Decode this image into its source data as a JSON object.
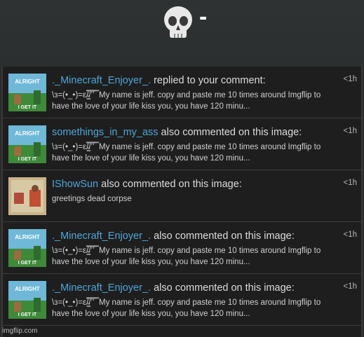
{
  "header": {
    "emoji": "💀",
    "dash": "-"
  },
  "notifications": [
    {
      "username": "._Minecraft_Enjoyer_.",
      "action": " replied to your comment:",
      "text": "\\з=(•_•)=ε/̵͇̿̿/’̿’̿ ̿ My name is jeff. copy and paste me 10 times around Imgflip to have the love of your life kiss you, you have 120 minu...",
      "time": "<1h",
      "thumb": "alright"
    },
    {
      "username": "somethings_in_my_ass",
      "action": " also commented on this image:",
      "text": "\\з=(•_•)=ε/̵͇̿̿/’̿’̿ ̿ My name is jeff. copy and paste me 10 times around Imgflip to have the love of your life kiss you, you have 120 minu...",
      "time": "<1h",
      "thumb": "alright"
    },
    {
      "username": "IShowSun",
      "action": " also commented on this image:",
      "text": "greetings dead corpse",
      "time": "<1h",
      "thumb": "painting"
    },
    {
      "username": "._Minecraft_Enjoyer_.",
      "action": " also commented on this image:",
      "text": "\\з=(•_•)=ε/̵͇̿̿/’̿’̿ ̿ My name is jeff. copy and paste me 10 times around Imgflip to have the love of your life kiss you, you have 120 minu...",
      "time": "<1h",
      "thumb": "alright"
    },
    {
      "username": "._Minecraft_Enjoyer_.",
      "action": " also commented on this image:",
      "text": "\\з=(•_•)=ε/̵͇̿̿/’̿’̿ ̿ My name is jeff. copy and paste me 10 times around Imgflip to have the love of your life kiss you, you have 120 minu...",
      "time": "<1h",
      "thumb": "alright"
    }
  ],
  "thumbs": {
    "alright": {
      "top": "ALRIGHT",
      "bottom": "I GET IT"
    }
  },
  "watermark": "imgflip.com",
  "colors": {
    "username": "#4ea6da",
    "background": "#1e1e1e"
  }
}
